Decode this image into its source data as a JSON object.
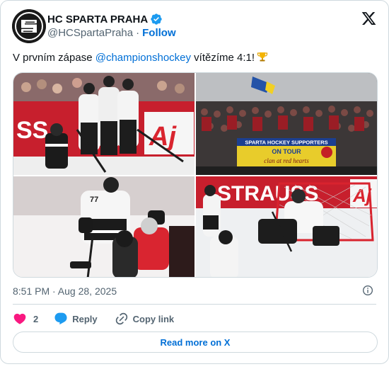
{
  "account": {
    "display_name": "HC SPARTA PRAHA",
    "handle": "@HCSpartaPraha",
    "separator": "·",
    "follow_label": "Follow",
    "verified_color": "#1d9bf0",
    "avatar_icon": "sparta-logo-icon"
  },
  "tweet": {
    "text_before": "V prvním zápase ",
    "mention": "@championshockey",
    "text_after": " vítězíme 4:1!",
    "emoji_icon": "trophy-icon",
    "photos": [
      {
        "sign_text": "Aj"
      },
      {
        "banner_line1": "SPARTA HOCKEY SUPPORTERS",
        "banner_line2": "ON TOUR",
        "banner_line3": "clan at red hearts"
      },
      {
        "jersey_number": "77"
      },
      {
        "board_text": "STRAUSS",
        "board_text2": "Aj"
      }
    ]
  },
  "meta": {
    "timestamp": "8:51 PM · Aug 28, 2025"
  },
  "actions": {
    "like_count": "2",
    "reply_label": "Reply",
    "copy_label": "Copy link"
  },
  "footer": {
    "read_more_label": "Read more on X"
  },
  "colors": {
    "link": "#006fd6",
    "like": "#f91880",
    "reply": "#1d9bf0",
    "muted": "#536471",
    "border": "#cfd9de"
  }
}
